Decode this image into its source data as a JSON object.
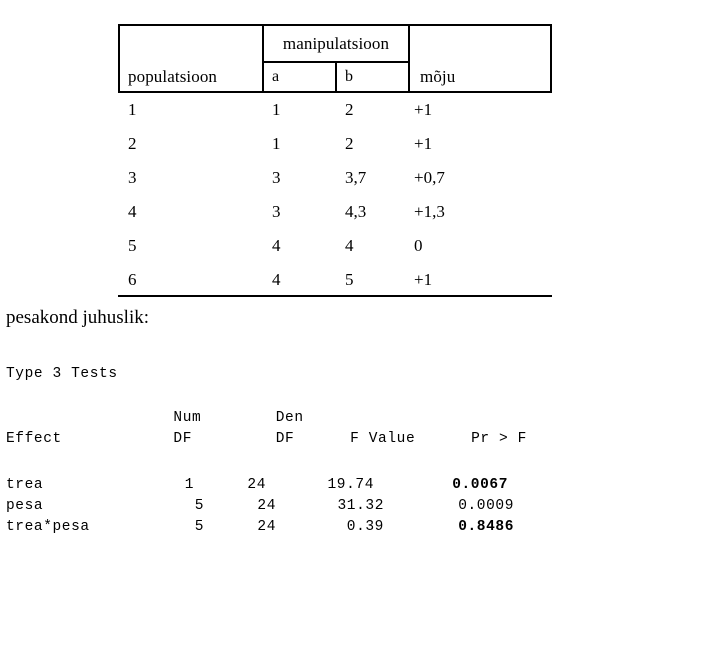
{
  "design_table": {
    "headers": {
      "population": "populatsioon",
      "manipulation": "manipulatsioon",
      "treatment_a": "a",
      "treatment_b": "b",
      "effect": "mõju"
    },
    "rows": [
      {
        "population": "1",
        "a": "1",
        "b": "2",
        "moju": "+1"
      },
      {
        "population": "2",
        "a": "1",
        "b": "2",
        "moju": "+1"
      },
      {
        "population": "3",
        "a": "3",
        "b": "3,7",
        "moju": "+0,7"
      },
      {
        "population": "4",
        "a": "3",
        "b": "4,3",
        "moju": "+1,3"
      },
      {
        "population": "5",
        "a": "4",
        "b": "4",
        "moju": "0"
      },
      {
        "population": "6",
        "a": "4",
        "b": "5",
        "moju": "+1"
      }
    ]
  },
  "caption": "pesakond juhuslik:",
  "sas_output": {
    "title": "Type 3 Tests",
    "header_line_1": "                  Num        Den",
    "header_line_2": "Effect            DF         DF      F Value      Pr > F",
    "columns": [
      "Effect",
      "Num DF",
      "Den DF",
      "F Value",
      "Pr > F"
    ],
    "rows": [
      {
        "effect": "trea",
        "num_df": "1",
        "den_df": "24",
        "f_value": "19.74",
        "pr_f": "0.0067",
        "pr_f_bold": true,
        "shift": false
      },
      {
        "effect": "pesa",
        "num_df": "5",
        "den_df": "24",
        "f_value": "31.32",
        "pr_f": "0.0009",
        "pr_f_bold": false,
        "shift": true
      },
      {
        "effect": "trea*pesa",
        "num_df": "5",
        "den_df": "24",
        "f_value": "0.39",
        "pr_f": "0.8486",
        "pr_f_bold": true,
        "shift": true
      }
    ]
  },
  "colors": {
    "text": "#000000",
    "background": "#ffffff",
    "rule": "#000000"
  }
}
